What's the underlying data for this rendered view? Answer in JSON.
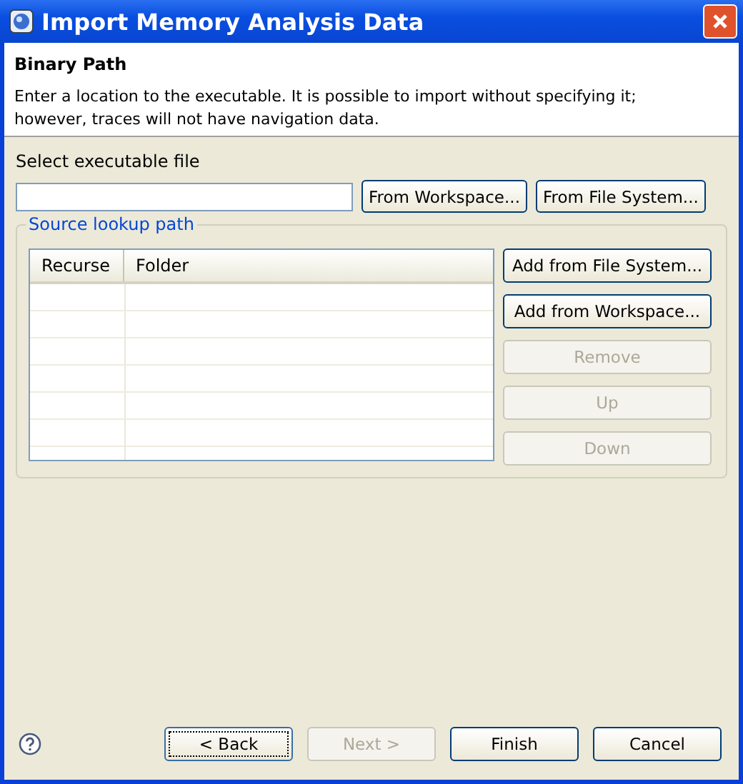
{
  "window": {
    "title": "Import Memory Analysis Data"
  },
  "header": {
    "title": "Binary Path",
    "description": "Enter a location to the executable. It is possible to import without specifying it; however, traces will not have navigation data."
  },
  "executable": {
    "label": "Select executable file",
    "buttons": [
      "From Workspace...",
      "From File System..."
    ]
  },
  "source_lookup": {
    "title": "Source lookup path",
    "columns": [
      "Recurse",
      "Folder"
    ],
    "buttons": [
      {
        "label": "Add from File System...",
        "disabled": false
      },
      {
        "label": "Add from Workspace...",
        "disabled": false
      },
      {
        "label": "Remove",
        "disabled": true
      },
      {
        "label": "Up",
        "disabled": true
      },
      {
        "label": "Down",
        "disabled": true
      }
    ]
  },
  "footer": {
    "buttons": [
      {
        "label": "< Back",
        "disabled": false,
        "focused": true
      },
      {
        "label": "Next >",
        "disabled": true,
        "focused": false
      },
      {
        "label": "Finish",
        "disabled": false,
        "focused": false
      },
      {
        "label": "Cancel",
        "disabled": false,
        "focused": false
      }
    ]
  }
}
